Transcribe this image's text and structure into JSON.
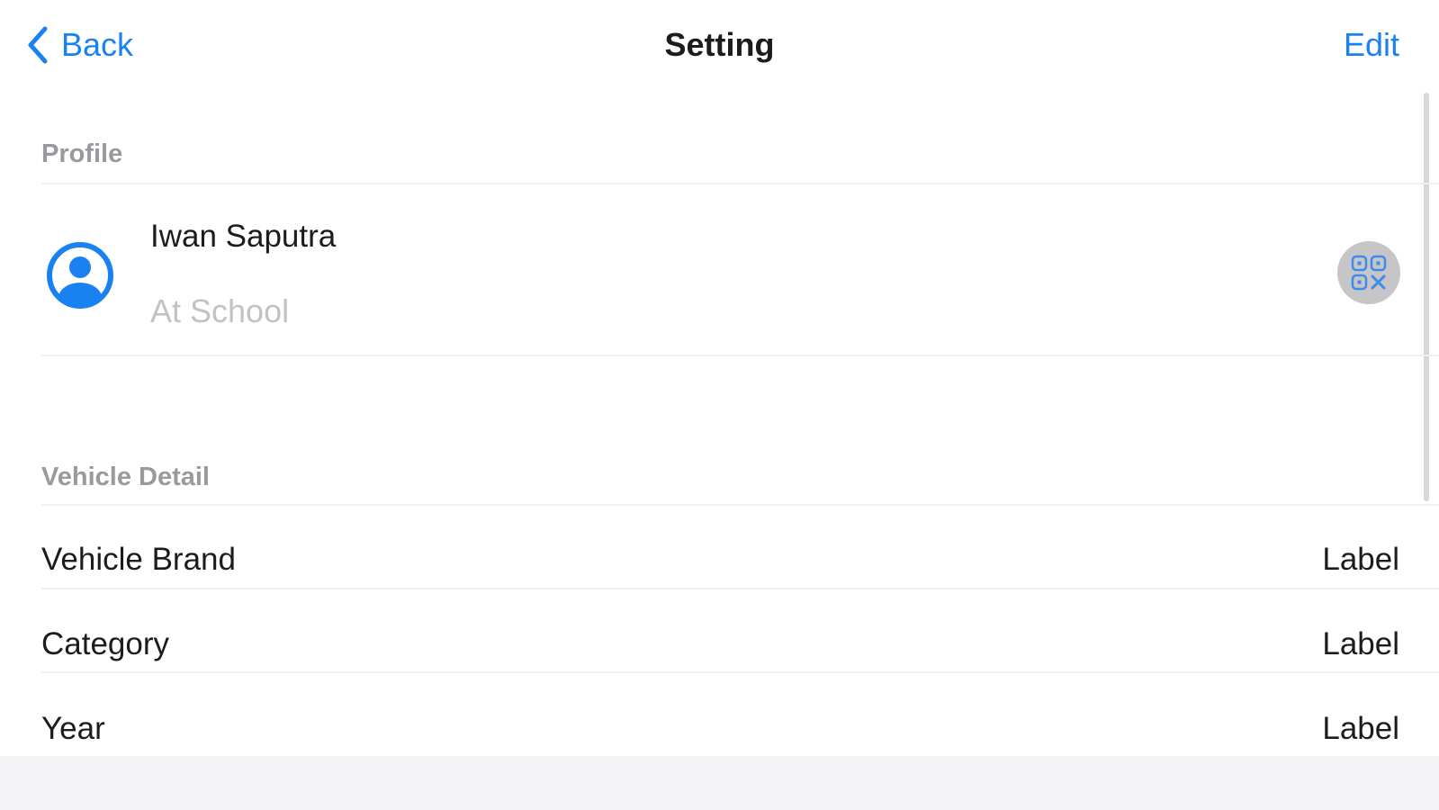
{
  "nav": {
    "back_label": "Back",
    "title": "Setting",
    "edit_label": "Edit"
  },
  "profile_section": {
    "header": "Profile",
    "name": "Iwan Saputra",
    "status": "At School"
  },
  "vehicle_section": {
    "header": "Vehicle Detail",
    "rows": [
      {
        "label": "Vehicle Brand",
        "value": "Label"
      },
      {
        "label": "Category",
        "value": "Label"
      },
      {
        "label": "Year",
        "value": "Label"
      }
    ]
  },
  "icons": {
    "back": "chevron-left-icon",
    "avatar": "user-circle-icon",
    "qr": "qr-code-icon"
  },
  "colors": {
    "accent": "#1a82f0",
    "secondary_text": "#9a9a9e",
    "placeholder_text": "#c2c2c6",
    "qr_button_bg": "#c6c6c9"
  }
}
